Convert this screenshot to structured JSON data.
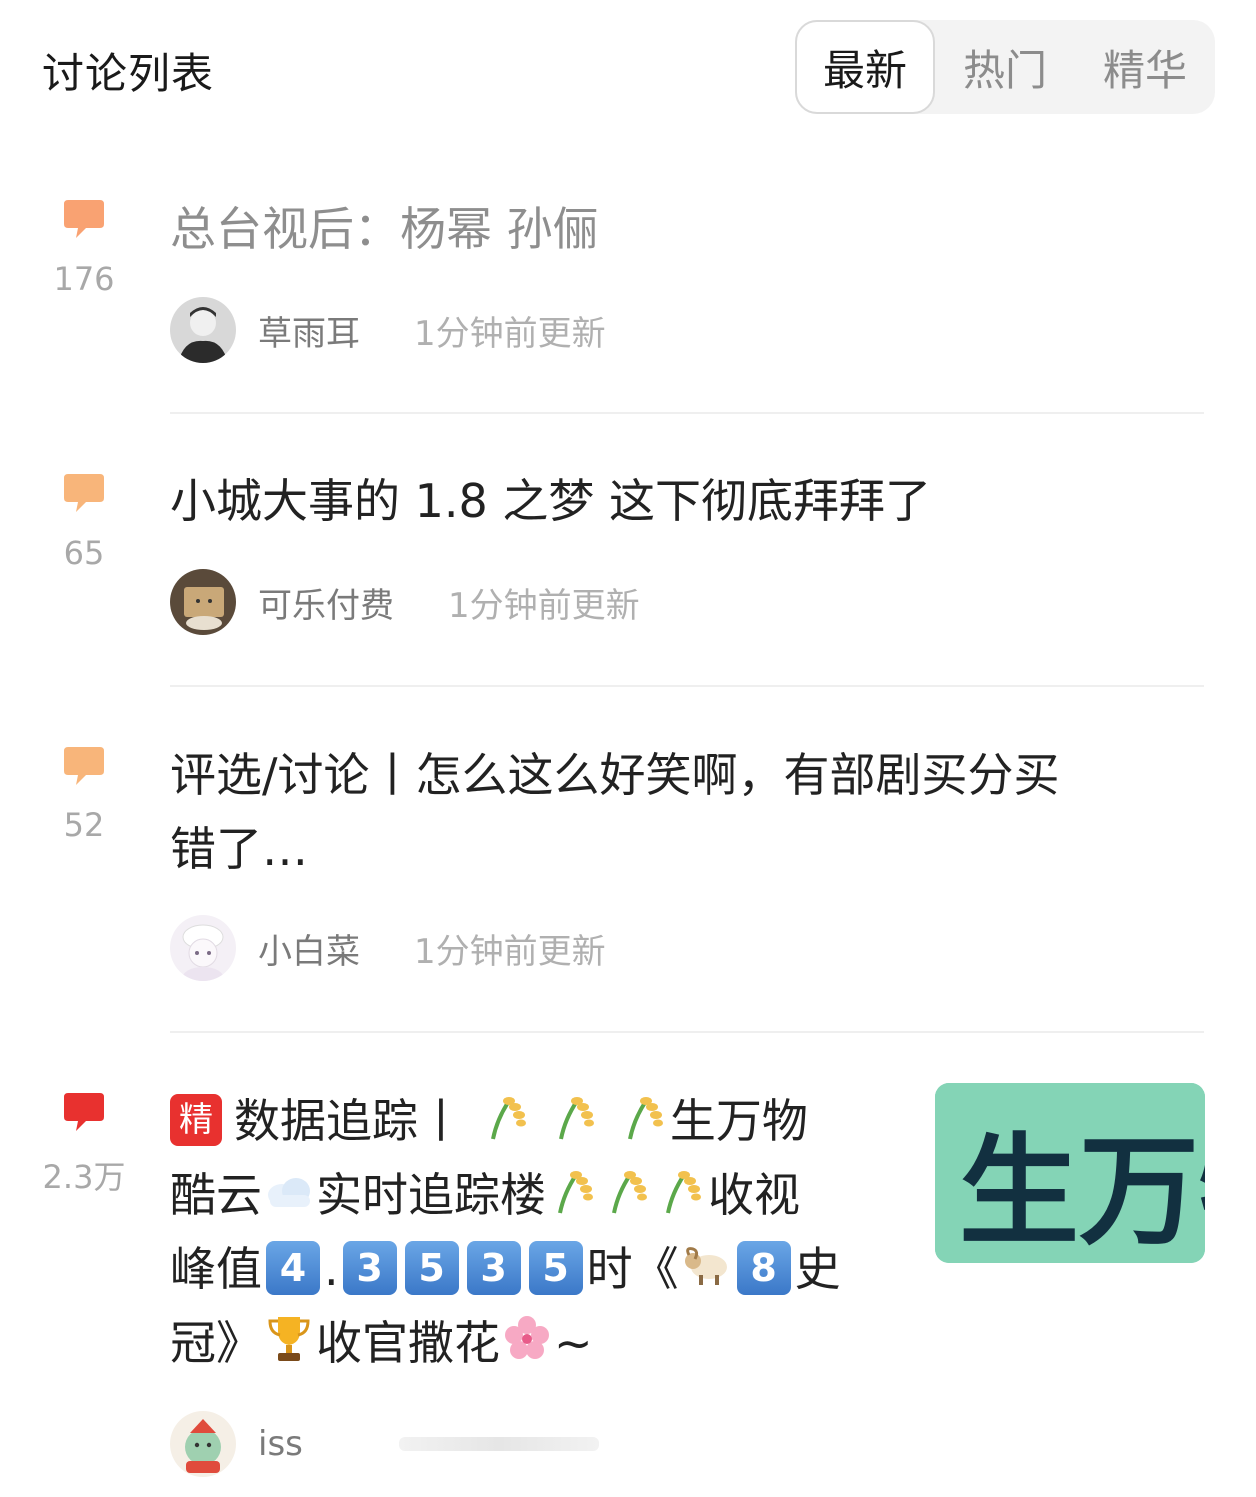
{
  "header": {
    "title": "讨论列表",
    "tabs": [
      {
        "label": "最新",
        "active": true
      },
      {
        "label": "热门",
        "active": false
      },
      {
        "label": "精华",
        "active": false
      }
    ]
  },
  "colors": {
    "bubble_orange": "#f9a272",
    "bubble_light": "#f8b57a",
    "bubble_red": "#e8312f",
    "thumb_green": "#84d4b6"
  },
  "items": [
    {
      "count": "176",
      "title": "总台视后：杨幂 孙俪",
      "author": "草雨耳",
      "time": "1分钟前更新",
      "bubble_icon": "comment-bubble-icon"
    },
    {
      "count": "65",
      "title": "小城大事的 1.8 之梦 这下彻底拜拜了",
      "author": "可乐付费",
      "time": "1分钟前更新",
      "bubble_icon": "comment-bubble-icon"
    },
    {
      "count": "52",
      "title_line1": "评选/讨论丨怎么这么好笑啊，有部剧买分买",
      "title_line2": "错了…",
      "author": "小白菜",
      "time": "1分钟前更新",
      "bubble_icon": "comment-bubble-icon"
    },
    {
      "count": "2.3万",
      "badge": "精",
      "t1": "数据追踪丨",
      "t2": "生万物",
      "t3": "酷云",
      "t4": "实时追踪楼",
      "t5": "收视",
      "t6": "峰值",
      "d1": "4",
      "dot": ".",
      "d2": "3",
      "d3": "5",
      "d4": "3",
      "d5": "5",
      "t7": "时《",
      "d6": "8",
      "t8": "史",
      "t9": "冠》",
      "t10": "收官撒花",
      "t11": "~",
      "author": "iss",
      "thumb_text": "生万物",
      "bubble_icon": "comment-bubble-icon"
    }
  ]
}
